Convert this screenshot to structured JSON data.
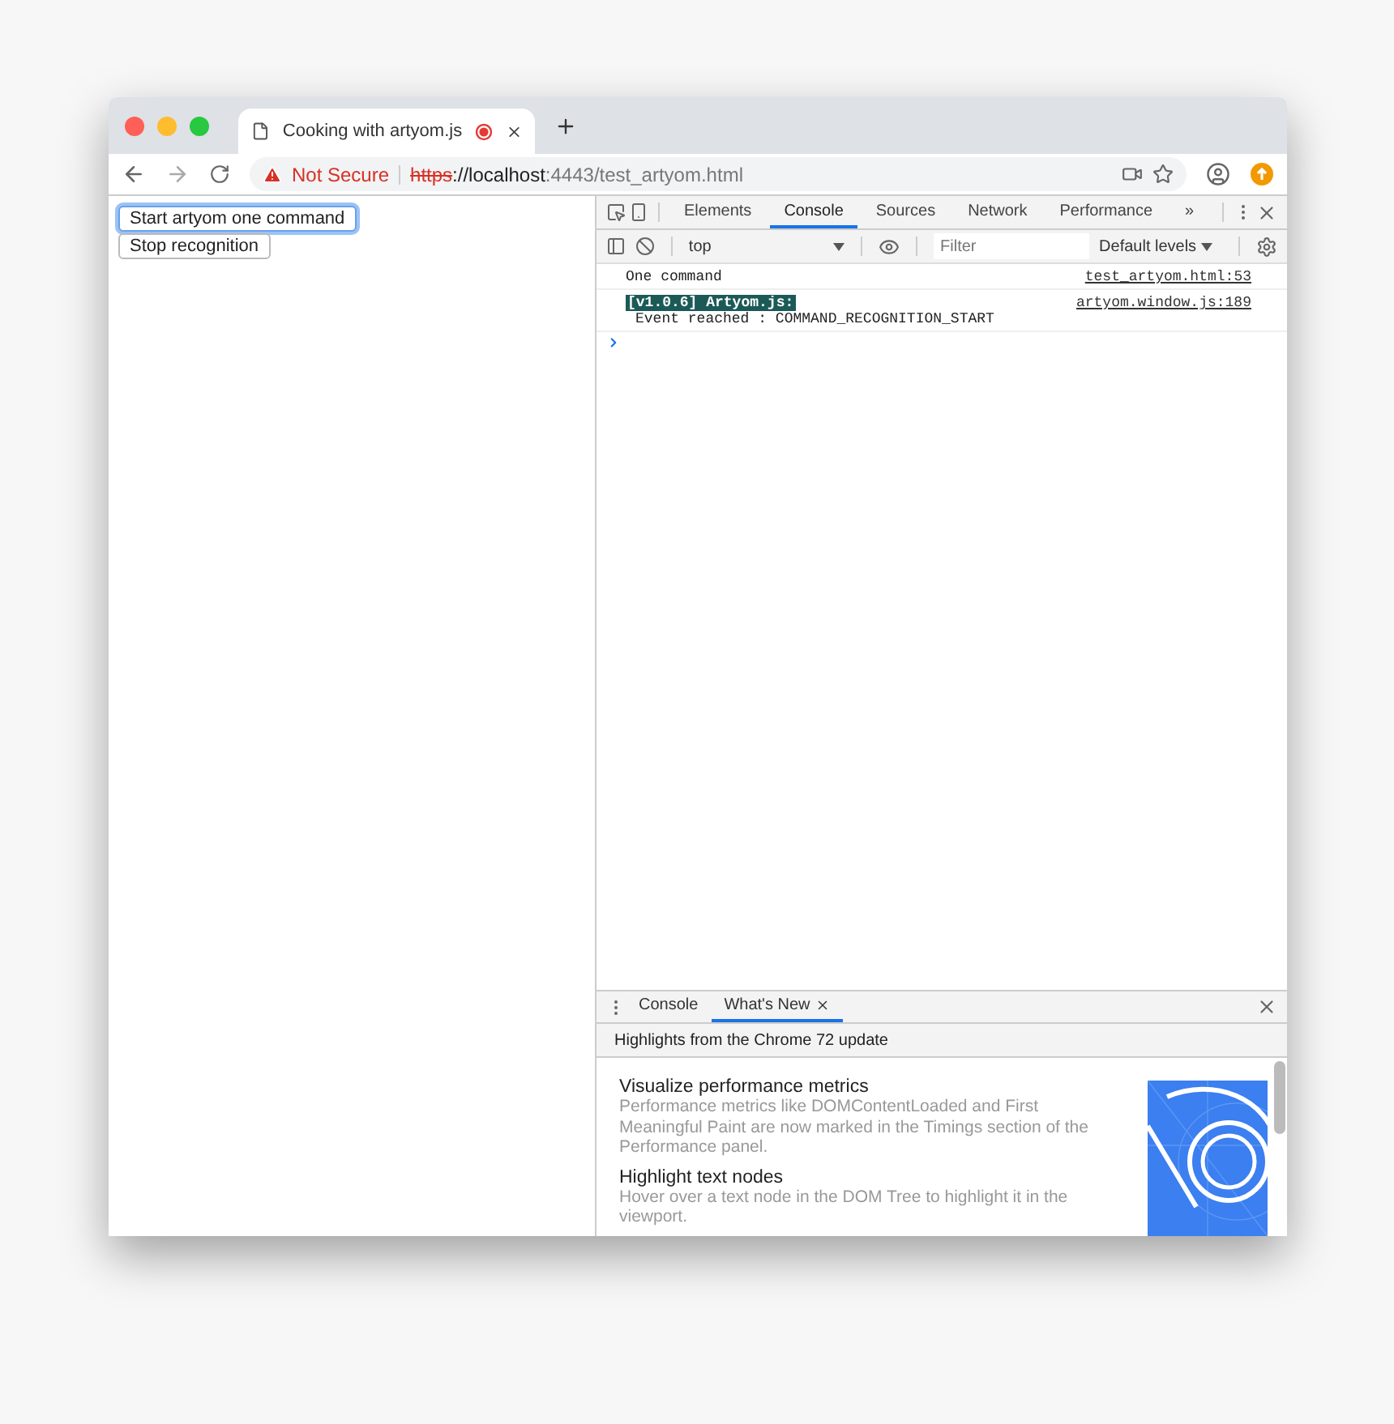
{
  "browser_tab": {
    "title": "Cooking with artyom.js",
    "recording": true
  },
  "address_bar": {
    "security": "Not Secure",
    "scheme": "https",
    "rest_host": "://localhost",
    "port_path": ":4443/test_artyom.html"
  },
  "page_buttons": [
    {
      "label": "Start artyom one command",
      "focused": true
    },
    {
      "label": "Stop recognition",
      "focused": false
    }
  ],
  "devtools": {
    "tabs": [
      {
        "label": "Elements",
        "selected": false
      },
      {
        "label": "Console",
        "selected": true
      },
      {
        "label": "Sources",
        "selected": false
      },
      {
        "label": "Network",
        "selected": false
      },
      {
        "label": "Performance",
        "selected": false
      }
    ],
    "overflow": "»",
    "context": "top",
    "filter_placeholder": "Filter",
    "levels": "Default levels",
    "messages": [
      {
        "text": "One command",
        "source": "test_artyom.html:53"
      },
      {
        "badge": "[v1.0.6] Artyom.js:",
        "text": "Event reached : COMMAND_RECOGNITION_START",
        "source": "artyom.window.js:189"
      }
    ]
  },
  "drawer": {
    "tabs": [
      {
        "label": "Console",
        "selected": false,
        "closable": false
      },
      {
        "label": "What's New",
        "selected": true,
        "closable": true
      }
    ],
    "header": "Highlights from the Chrome 72 update",
    "items": [
      {
        "title": "Visualize performance metrics",
        "description": "Performance metrics like DOMContentLoaded and First Meaningful Paint are now marked in the Timings section of the Performance panel."
      },
      {
        "title": "Highlight text nodes",
        "description": "Hover over a text node in the DOM Tree to highlight it in the viewport."
      }
    ]
  }
}
